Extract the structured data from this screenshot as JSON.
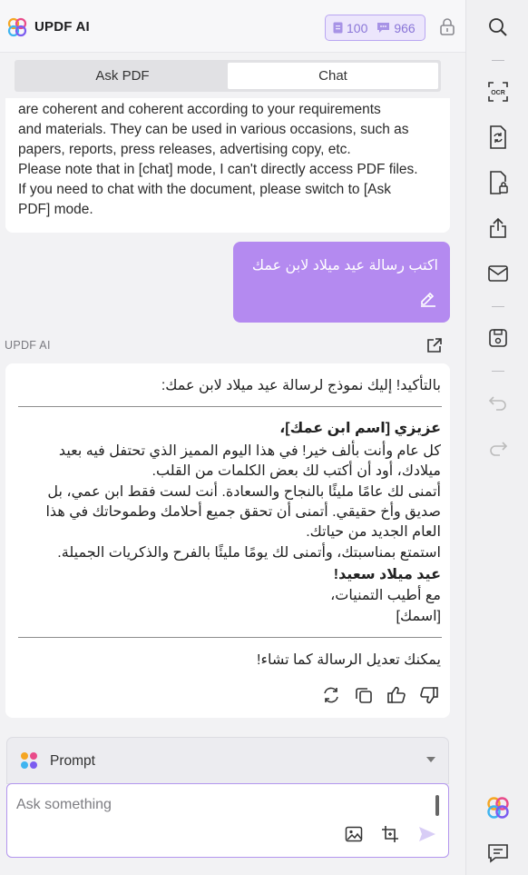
{
  "header": {
    "brand": "UPDF AI",
    "credits_docs": "100",
    "credits_chats": "966"
  },
  "tabs": [
    {
      "label": "Ask PDF",
      "active": false
    },
    {
      "label": "Chat",
      "active": true
    }
  ],
  "chat": {
    "prev_ai_lines": [
      "are coherent and coherent according to your requirements",
      "and materials. They can be used in various occasions, such as",
      "papers, reports, press releases, advertising copy, etc.",
      "Please note that in [chat] mode, I can't directly access PDF files.",
      "If you need to chat with the document, please switch to [Ask",
      "PDF] mode."
    ],
    "user_message": "اكتب رسالة عيد ميلاد لابن عمك",
    "ai_label": "UPDF AI",
    "ai_intro": "بالتأكيد! إليك نموذج لرسالة عيد ميلاد لابن عمك:",
    "greeting": "عزيزي [اسم ابن عمك]،",
    "paragraph1": "كل عام وأنت بألف خير! في هذا اليوم المميز الذي تحتفل فيه بعيد ميلادك، أود أن أكتب لك بعض الكلمات من القلب.",
    "paragraph2": "أتمنى لك عامًا مليئًا بالنجاح والسعادة. أنت لست فقط ابن عمي، بل صديق وأخ حقيقي. أتمنى أن تحقق جميع أحلامك وطموحاتك في هذا العام الجديد من حياتك.",
    "paragraph3": "استمتع بمناسبتك، وأتمنى لك يومًا مليئًا بالفرح والذكريات الجميلة.",
    "wish": "عيد ميلاد سعيد!",
    "closing": "مع أطيب التمنيات،",
    "signature": "[اسمك]",
    "ai_footer": "يمكنك تعديل الرسالة كما تشاء!"
  },
  "prompt": {
    "label": "Prompt"
  },
  "input": {
    "placeholder": "Ask something"
  },
  "colors": {
    "accent": "#b48af0",
    "user_bubble": "#b48af0",
    "credit_text": "#8a76d8"
  }
}
